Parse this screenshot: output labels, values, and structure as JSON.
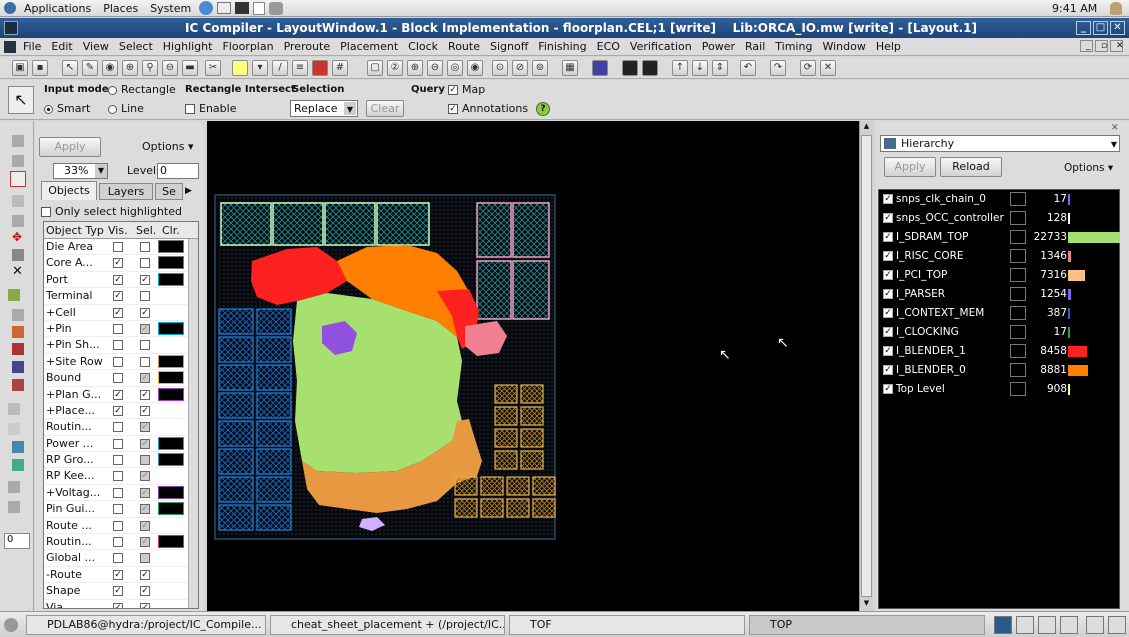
{
  "topbar": {
    "applications": "Applications",
    "places": "Places",
    "system": "System",
    "clock": "9:41 AM"
  },
  "window": {
    "title": "IC Compiler - LayoutWindow.1 - Block Implementation - floorplan.CEL;1 [write]    Lib:ORCA_IO.mw [write] - [Layout.1]"
  },
  "menu": [
    "File",
    "Edit",
    "View",
    "Select",
    "Highlight",
    "Floorplan",
    "Preroute",
    "Placement",
    "Clock",
    "Route",
    "Signoff",
    "Finishing",
    "ECO",
    "Verification",
    "Power",
    "Rail",
    "Timing",
    "Window",
    "Help"
  ],
  "toolbar2": {
    "input_mode_label": "Input mode",
    "rectangle": "Rectangle",
    "smart": "Smart",
    "line": "Line",
    "rect_intersect_label": "Rectangle Intersect",
    "enable": "Enable",
    "selection_label": "Selection",
    "selection_value": "Replace",
    "clear": "Clear",
    "query_label": "Query",
    "map": "Map",
    "annotations": "Annotations"
  },
  "left": {
    "apply": "Apply",
    "options": "Options",
    "zoom": "33%",
    "level_label": "Level",
    "level_value": "0",
    "tabs": [
      "Objects",
      "Layers",
      "Se"
    ],
    "only_selected": "Only select highlighted",
    "headers": [
      "Object Typ",
      "Vis.",
      "Sel.",
      "Clr."
    ],
    "rows": [
      {
        "name": "Die Area",
        "exp": "",
        "vis": "",
        "sel": "",
        "sg": false,
        "sw": "#000000",
        "sb": "#777"
      },
      {
        "name": "Core A...",
        "exp": "",
        "vis": "✓",
        "sel": "",
        "sg": false,
        "sw": "#000000",
        "sb": "#777"
      },
      {
        "name": "Port",
        "exp": "",
        "vis": "✓",
        "sel": "✓",
        "sg": false,
        "sw": "#000000",
        "sb": "#00b0d0"
      },
      {
        "name": "Terminal",
        "exp": "",
        "vis": "✓",
        "sel": "",
        "sg": false,
        "sw": "",
        "sb": ""
      },
      {
        "name": "Cell",
        "exp": "+",
        "vis": "✓",
        "sel": "✓",
        "sg": false,
        "sw": "",
        "sb": ""
      },
      {
        "name": "Pin",
        "exp": "+",
        "vis": "",
        "sel": "✓",
        "sg": true,
        "sw": "#000000",
        "sb": "#00b0d0"
      },
      {
        "name": "Pin Sh...",
        "exp": "+",
        "vis": "",
        "sel": "",
        "sg": false,
        "sw": "",
        "sb": ""
      },
      {
        "name": "Site Row",
        "exp": "+",
        "vis": "",
        "sel": "",
        "sg": false,
        "sw": "#000000",
        "sb": "#c8a040"
      },
      {
        "name": "Bound",
        "exp": "",
        "vis": "",
        "sel": "✓",
        "sg": true,
        "sw": "#000000",
        "sb": "#d8c020"
      },
      {
        "name": "Plan G...",
        "exp": "+",
        "vis": "✓",
        "sel": "✓",
        "sg": false,
        "sw": "#000000",
        "sb": "#a040c0"
      },
      {
        "name": "Place...",
        "exp": "+",
        "vis": "✓",
        "sel": "✓",
        "sg": false,
        "sw": "",
        "sb": ""
      },
      {
        "name": "Routin...",
        "exp": "",
        "vis": "",
        "sel": "✓",
        "sg": true,
        "sw": "",
        "sb": ""
      },
      {
        "name": "Power ...",
        "exp": "",
        "vis": "",
        "sel": "✓",
        "sg": true,
        "sw": "#000000",
        "sb": "#20a0c0"
      },
      {
        "name": "RP Gro...",
        "exp": "",
        "vis": "",
        "sel": "",
        "sg": true,
        "sw": "#000000",
        "sb": "#20a0c0"
      },
      {
        "name": "RP Kee...",
        "exp": "",
        "vis": "",
        "sel": "✓",
        "sg": true,
        "sw": "",
        "sb": ""
      },
      {
        "name": "Voltag...",
        "exp": "+",
        "vis": "",
        "sel": "✓",
        "sg": true,
        "sw": "#000000",
        "sb": "#8040a0"
      },
      {
        "name": "Pin Gui...",
        "exp": "",
        "vis": "",
        "sel": "✓",
        "sg": true,
        "sw": "#000000",
        "sb": "#30a060"
      },
      {
        "name": "Route ...",
        "exp": "",
        "vis": "",
        "sel": "✓",
        "sg": true,
        "sw": "",
        "sb": ""
      },
      {
        "name": "Routin...",
        "exp": "",
        "vis": "",
        "sel": "✓",
        "sg": true,
        "sw": "#000000",
        "sb": "#c04040"
      },
      {
        "name": "Global ...",
        "exp": "",
        "vis": "",
        "sel": "",
        "sg": true,
        "sw": "",
        "sb": ""
      },
      {
        "name": "Route",
        "exp": "-",
        "vis": "✓",
        "sel": "✓",
        "sg": false,
        "sw": "",
        "sb": ""
      },
      {
        "name": "Shape",
        "exp": "",
        "vis": "✓",
        "sel": "✓",
        "sg": false,
        "sw": "",
        "sb": ""
      },
      {
        "name": "Via",
        "exp": "",
        "vis": "✓",
        "sel": "✓",
        "sg": false,
        "sw": "",
        "sb": ""
      }
    ]
  },
  "right": {
    "dropdown": "Hierarchy",
    "apply": "Apply",
    "reload": "Reload",
    "options": "Options",
    "rows": [
      {
        "name": "snps_clk_chain_0",
        "count": "17",
        "color": "#9060ff",
        "bar": 0.03
      },
      {
        "name": "snps_OCC_controller",
        "count": "128",
        "color": "#ffffff",
        "bar": 0.02
      },
      {
        "name": "I_SDRAM_TOP",
        "count": "22733",
        "color": "#a8e070",
        "bar": 1
      },
      {
        "name": "I_RISC_CORE",
        "count": "1346",
        "color": "#f08090",
        "bar": 0.06
      },
      {
        "name": "I_PCI_TOP",
        "count": "7316",
        "color": "#ffc080",
        "bar": 0.32
      },
      {
        "name": "I_PARSER",
        "count": "1254",
        "color": "#8060ff",
        "bar": 0.06
      },
      {
        "name": "I_CONTEXT_MEM",
        "count": "387",
        "color": "#3060c0",
        "bar": 0.03
      },
      {
        "name": "I_CLOCKING",
        "count": "17",
        "color": "#30a040",
        "bar": 0.02
      },
      {
        "name": "I_BLENDER_1",
        "count": "8458",
        "color": "#ff2020",
        "bar": 0.37
      },
      {
        "name": "I_BLENDER_0",
        "count": "8881",
        "color": "#ff8000",
        "bar": 0.39
      },
      {
        "name": "Top Level",
        "count": "908",
        "color": "#ffff80",
        "bar": 0.04
      }
    ]
  },
  "taskbar": [
    "PDLAB86@hydra:/project/IC_Compile...",
    "cheat_sheet_placement + (/project/IC...",
    "TOF",
    "TOP"
  ],
  "colors": {
    "title_bg": "#1d4478",
    "canvas_bg": "#000000"
  }
}
